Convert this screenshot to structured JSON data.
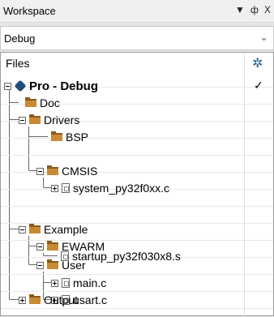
{
  "window": {
    "title": "Workspace",
    "controls": {
      "menu": "▼",
      "pin": "ф",
      "close": "X"
    }
  },
  "configuration": {
    "selected": "Debug",
    "arrow": "⌄"
  },
  "tree_header": {
    "files_label": "Files",
    "options_icon": "gear-icon"
  },
  "tree": [
    {
      "label": "Pro - Debug",
      "type": "project",
      "expanded": true,
      "checked": "✓"
    },
    {
      "label": "Doc",
      "type": "folder"
    },
    {
      "label": "Drivers",
      "type": "folder",
      "expanded": true
    },
    {
      "label": "BSP",
      "type": "folder"
    },
    {
      "label": "CMSIS",
      "type": "folder",
      "expanded": true
    },
    {
      "label": "system_py32f0xx.c",
      "type": "file",
      "collapsed": true
    },
    {
      "label": "Example",
      "type": "folder",
      "expanded": true
    },
    {
      "label": "EWARM",
      "type": "folder",
      "expanded": true
    },
    {
      "label": "startup_py32f030x8.s",
      "type": "file"
    },
    {
      "label": "User",
      "type": "folder",
      "expanded": true
    },
    {
      "label": "main.c",
      "type": "file",
      "collapsed": true
    },
    {
      "label": "usart.c",
      "type": "file",
      "collapsed": true
    },
    {
      "label": "Output",
      "type": "folder",
      "collapsed": true
    }
  ],
  "colors": {
    "folder": "#c98a34",
    "project": "#1f4b7a",
    "accent": "#1f5f8b"
  }
}
